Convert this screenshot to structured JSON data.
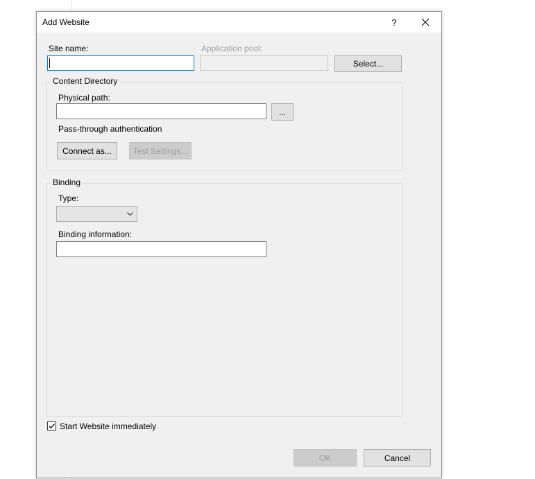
{
  "dialog": {
    "title": "Add Website",
    "help_label": "?"
  },
  "site_name": {
    "label": "Site name:",
    "value": ""
  },
  "application_pool": {
    "label": "Application pool:",
    "value": "",
    "select_label": "Select..."
  },
  "content_directory": {
    "group_label": "Content Directory",
    "physical_path_label": "Physical path:",
    "physical_path_value": "",
    "browse_label": "...",
    "passthrough_label": "Pass-through authentication",
    "connect_as_label": "Connect as...",
    "test_settings_label": "Test Settings..."
  },
  "binding": {
    "group_label": "Binding",
    "type_label": "Type:",
    "type_value": "",
    "info_label": "Binding information:",
    "info_value": ""
  },
  "start_immediately": {
    "label": "Start Website immediately",
    "checked": true
  },
  "footer": {
    "ok_label": "OK",
    "cancel_label": "Cancel"
  }
}
